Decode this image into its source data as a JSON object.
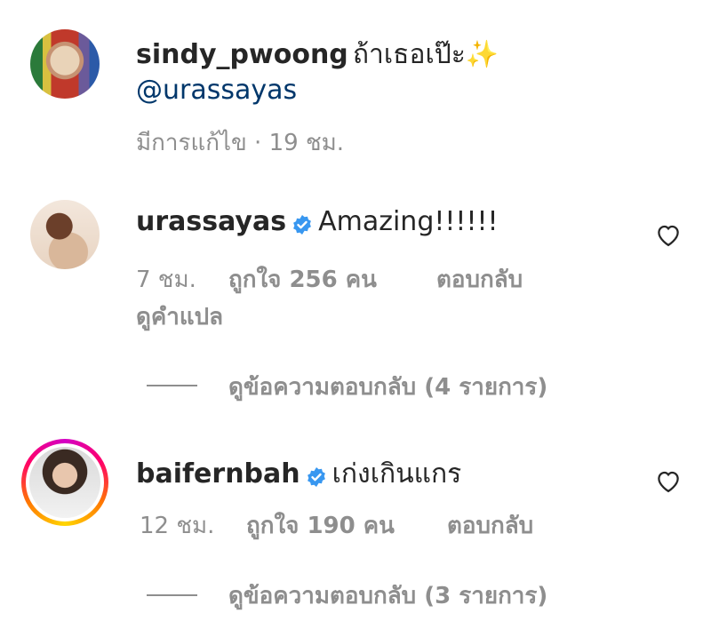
{
  "colors": {
    "text": "#262626",
    "secondary": "#8e8e8e",
    "verified": "#3897f0"
  },
  "comments": [
    {
      "username": "sindy_pwoong",
      "text": "ถ้าเธอเป๊ะ✨",
      "mention": "@urassayas",
      "meta": "มีการแก้ไข · 19 ชม."
    },
    {
      "username": "urassayas",
      "verified": true,
      "text": "Amazing!!!!!!",
      "time": "7 ชม.",
      "likes": "ถูกใจ 256 คน",
      "reply": "ตอบกลับ",
      "translate": "ดูคำแปล",
      "view_replies": "ดูข้อความตอบกลับ (4 รายการ)"
    },
    {
      "username": "baifernbah",
      "verified": true,
      "text": "เก่งเกินแกร",
      "time": "12 ชม.",
      "likes": "ถูกใจ 190 คน",
      "reply": "ตอบกลับ",
      "view_replies": "ดูข้อความตอบกลับ (3 รายการ)"
    }
  ]
}
